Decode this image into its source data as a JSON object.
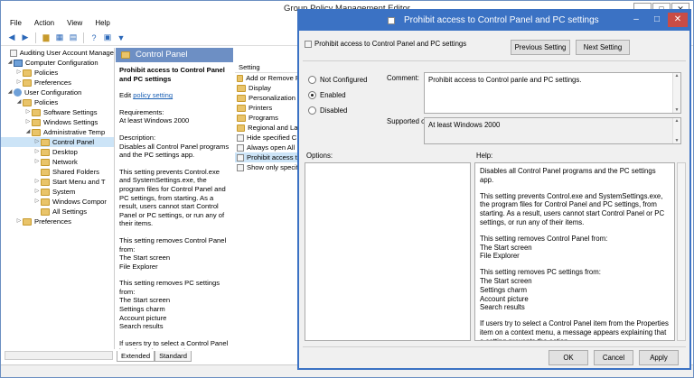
{
  "main_window": {
    "title": "Group Policy Management Editor",
    "menu": [
      "File",
      "Action",
      "View",
      "Help"
    ],
    "tree": [
      {
        "label": "Auditing User Account Manage",
        "indent": 0,
        "icon": "policy-doc-icon",
        "arrow": ""
      },
      {
        "label": "Computer Configuration",
        "indent": 1,
        "icon": "computer-icon",
        "arrow": "▲"
      },
      {
        "label": "Policies",
        "indent": 2,
        "icon": "folder-icon",
        "arrow": "▷"
      },
      {
        "label": "Preferences",
        "indent": 2,
        "icon": "folder-icon",
        "arrow": "▷"
      },
      {
        "label": "User Configuration",
        "indent": 1,
        "icon": "user-icon",
        "arrow": "▲"
      },
      {
        "label": "Policies",
        "indent": 2,
        "icon": "folder-icon",
        "arrow": "▲"
      },
      {
        "label": "Software Settings",
        "indent": 3,
        "icon": "folder-icon",
        "arrow": "▷"
      },
      {
        "label": "Windows Settings",
        "indent": 3,
        "icon": "folder-icon",
        "arrow": "▷"
      },
      {
        "label": "Administrative Temp",
        "indent": 3,
        "icon": "folder-icon",
        "arrow": "▲"
      },
      {
        "label": "Control Panel",
        "indent": 4,
        "icon": "folder-icon",
        "arrow": "▷",
        "selected": true
      },
      {
        "label": "Desktop",
        "indent": 4,
        "icon": "folder-icon",
        "arrow": "▷"
      },
      {
        "label": "Network",
        "indent": 4,
        "icon": "folder-icon",
        "arrow": "▷"
      },
      {
        "label": "Shared Folders",
        "indent": 4,
        "icon": "folder-icon",
        "arrow": ""
      },
      {
        "label": "Start Menu and T",
        "indent": 4,
        "icon": "folder-icon",
        "arrow": "▷"
      },
      {
        "label": "System",
        "indent": 4,
        "icon": "folder-icon",
        "arrow": "▷"
      },
      {
        "label": "Windows Compor",
        "indent": 4,
        "icon": "folder-icon",
        "arrow": "▷"
      },
      {
        "label": "All Settings",
        "indent": 4,
        "icon": "folder-icon",
        "arrow": ""
      },
      {
        "label": "Preferences",
        "indent": 1,
        "icon": "folder-icon",
        "arrow": "▷"
      }
    ],
    "desc_header": "Control Panel",
    "desc": {
      "title": "Prohibit access to Control Panel and PC settings",
      "edit_prefix": "Edit ",
      "edit_link": "policy setting",
      "requirements_label": "Requirements:",
      "requirements": "At least Windows 2000",
      "description_label": "Description:",
      "description": "Disables all Control Panel programs and the PC settings app.",
      "p1": "This setting prevents Control.exe and SystemSettings.exe, the program files for Control Panel and PC settings, from starting. As a result, users cannot start Control Panel or PC settings, or run any of their items.",
      "p2": "This setting removes Control Panel from:",
      "p2_items": [
        "The Start screen",
        "File Explorer"
      ],
      "p3": "This setting removes PC settings from:",
      "p3_items": [
        "The Start screen",
        "Settings charm",
        "Account picture",
        "Search results"
      ],
      "p4": "If users try to select a Control Panel item from the Properties"
    },
    "list_header": "Setting",
    "list": [
      {
        "label": "Add or Remove P",
        "icon": "folder-icon"
      },
      {
        "label": "Display",
        "icon": "folder-icon"
      },
      {
        "label": "Personalization",
        "icon": "folder-icon"
      },
      {
        "label": "Printers",
        "icon": "folder-icon"
      },
      {
        "label": "Programs",
        "icon": "folder-icon"
      },
      {
        "label": "Regional and Lar",
        "icon": "folder-icon"
      },
      {
        "label": "Hide specified C",
        "icon": "policy-icon"
      },
      {
        "label": "Always open All",
        "icon": "policy-icon"
      },
      {
        "label": "Prohibit access t",
        "icon": "policy-icon",
        "selected": true
      },
      {
        "label": "Show only specif",
        "icon": "policy-icon"
      }
    ],
    "tabs": [
      "Extended",
      "Standard"
    ]
  },
  "dialog": {
    "title": "Prohibit access to Control Panel and PC settings",
    "subheader": "Prohibit access to Control Panel and PC settings",
    "prev_button": "Previous Setting",
    "next_button": "Next Setting",
    "radios": [
      {
        "label": "Not Configured",
        "checked": false
      },
      {
        "label": "Enabled",
        "checked": true
      },
      {
        "label": "Disabled",
        "checked": false
      }
    ],
    "comment_label": "Comment:",
    "comment_value": "Prohibit access to Control panle and PC settings.",
    "supported_label": "Supported on:",
    "supported_value": "At least Windows 2000",
    "options_label": "Options:",
    "help_label": "Help:",
    "help": {
      "p1": "Disables all Control Panel programs and the PC settings app.",
      "p2": "This setting prevents Control.exe and SystemSettings.exe, the program files for Control Panel and PC settings, from starting. As a result, users cannot start Control Panel or PC settings, or run any of their items.",
      "p3_title": "This setting removes Control Panel from:",
      "p3_items": [
        "The Start screen",
        "File Explorer"
      ],
      "p4_title": "This setting removes PC settings from:",
      "p4_items": [
        "The Start screen",
        "Settings charm",
        "Account picture",
        "Search results"
      ],
      "p5": "If users try to select a Control Panel item from the Properties item on a context menu, a message appears explaining that a setting prevents the action."
    },
    "ok_button": "OK",
    "cancel_button": "Cancel",
    "apply_button": "Apply"
  },
  "colors": {
    "accent": "#3b72c4",
    "pane_header": "#6d8fc4",
    "close": "#c94c45"
  }
}
